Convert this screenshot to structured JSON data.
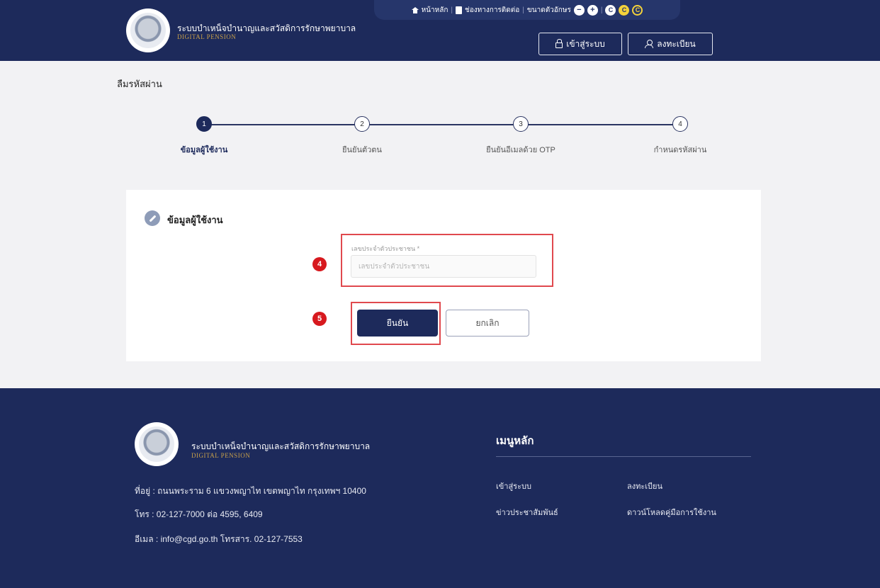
{
  "header": {
    "brand_name": "ระบบบำเหน็จบำนาญและสวัสดิการรักษาพยาบาล",
    "brand_sub": "DIGITAL PENSION",
    "topbar": {
      "home_label": "หน้าหลัก",
      "contact_label": "ช่องทางการติดต่อ",
      "fontsize_label": "ขนาดตัวอักษร",
      "fontsize_minus": "−",
      "fontsize_plus": "+",
      "contrast_labels": [
        "C",
        "C",
        "C"
      ]
    },
    "login_label": "เข้าสู่ระบบ",
    "register_label": "ลงทะเบียน"
  },
  "page_title": "ลืมรหัสผ่าน",
  "stepper": {
    "steps": [
      {
        "number": "1",
        "label": "ข้อมูลผู้ใช้งาน"
      },
      {
        "number": "2",
        "label": "ยืนยันตัวตน"
      },
      {
        "number": "3",
        "label": "ยืนยันอีเมลด้วย OTP"
      },
      {
        "number": "4",
        "label": "กำหนดรหัสผ่าน"
      }
    ]
  },
  "form": {
    "section_title": "ข้อมูลผู้ใช้งาน",
    "id_label": "เลขประจำตัวประชาชน *",
    "id_placeholder": "เลขประจำตัวประชาชน",
    "id_value": "",
    "annotation_4": "4",
    "annotation_5": "5",
    "confirm_label": "ยืนยัน",
    "cancel_label": "ยกเลิก"
  },
  "footer": {
    "brand_name": "ระบบบำเหน็จบำนาญและสวัสดิการรักษาพยาบาล",
    "brand_sub": "DIGITAL PENSION",
    "address": "ที่อยู่ : ถนนพระราม 6 แขวงพญาไท เขตพญาไท กรุงเทพฯ 10400",
    "phone": "โทร : 02-127-7000 ต่อ 4595, 6409",
    "email": "อีเมล : info@cgd.go.th โทรสาร. 02-127-7553",
    "menu_title": "เมนูหลัก",
    "links": {
      "login": "เข้าสู่ระบบ",
      "register": "ลงทะเบียน",
      "news": "ข่าวประชาสัมพันธ์",
      "manual": "ดาวน์โหลดคู่มือการใช้งาน"
    }
  },
  "colors": {
    "navy": "#1d2a5b",
    "highlight_red": "#e0494e",
    "badge_red": "#d7191e",
    "gold": "#c9a14a"
  }
}
